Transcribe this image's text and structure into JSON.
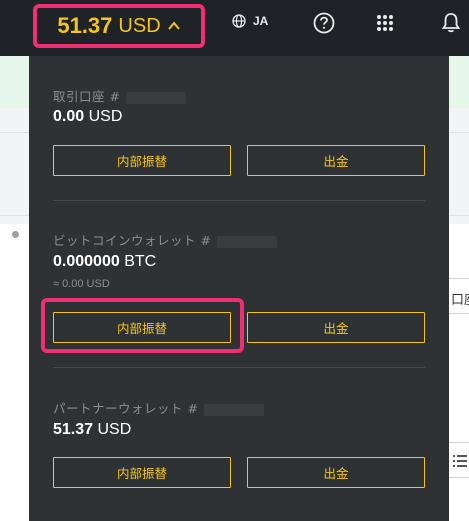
{
  "header": {
    "balance_amount": "51.37",
    "balance_currency": "USD",
    "language": "JA",
    "icons": [
      "chevron-up-icon",
      "globe-icon",
      "help-icon",
      "apps-grid-icon",
      "bell-icon"
    ]
  },
  "accounts": [
    {
      "label": "取引口座 #",
      "balance_amount": "0.00",
      "balance_currency": "USD",
      "transfer_label": "内部振替",
      "withdraw_label": "出金"
    },
    {
      "label": "ビットコインウォレット #",
      "balance_amount": "0.000000",
      "balance_currency": "BTC",
      "sub_value": "≈ 0.00 USD",
      "transfer_label": "内部振替",
      "withdraw_label": "出金"
    },
    {
      "label": "パートナーウォレット #",
      "balance_amount": "51.37",
      "balance_currency": "USD",
      "transfer_label": "内部振替",
      "withdraw_label": "出金"
    }
  ],
  "background": {
    "right_box_text": "口座関"
  },
  "colors": {
    "topbar": "#1f2327",
    "dropdown": "#2f3235",
    "accent_yellow": "#f5c518",
    "highlight_pink": "#ef2f72"
  }
}
